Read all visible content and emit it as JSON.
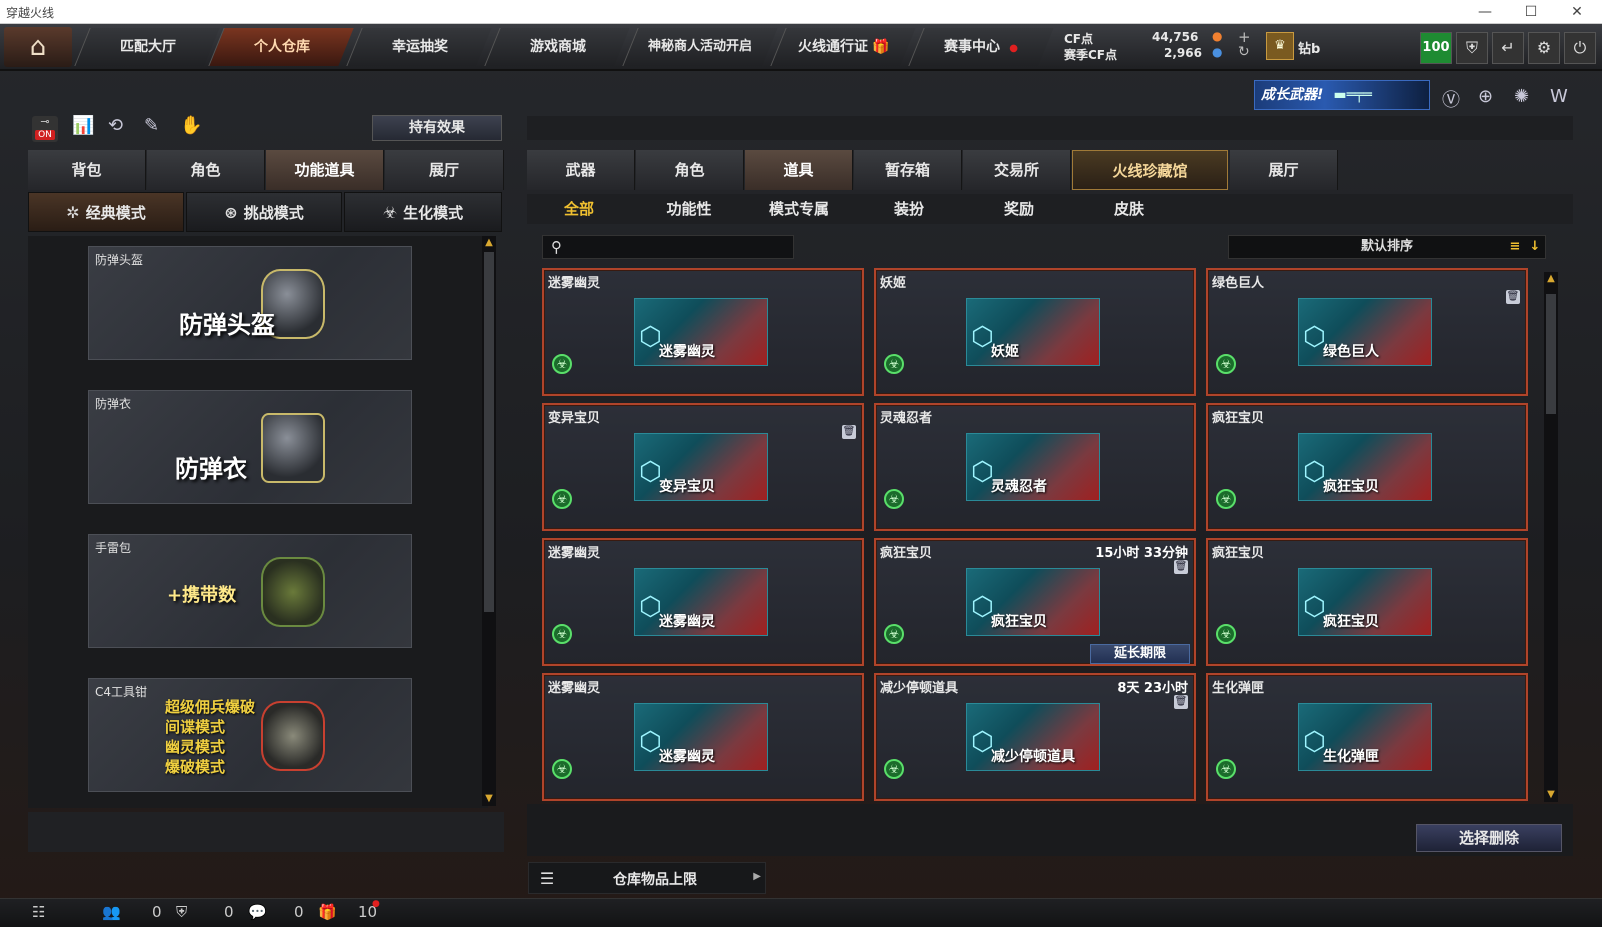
{
  "window": {
    "title": "穿越火线",
    "min": "—",
    "max": "☐",
    "close": "✕"
  },
  "nav": {
    "home_icon": "home-icon",
    "tabs": [
      {
        "label": "匹配大厅"
      },
      {
        "label": "个人仓库"
      },
      {
        "label": "幸运抽奖"
      },
      {
        "label": "游戏商城"
      },
      {
        "label": "神秘商人活动开启"
      },
      {
        "label": "火线通行证"
      },
      {
        "label": "赛事中心"
      }
    ],
    "cf_label": "CF点",
    "cf_value": "44,756",
    "season_cf_label": "赛季CF点",
    "season_cf_value": "2,966",
    "user_name": "钻b",
    "level": "100"
  },
  "banner": {
    "text": "成长武器!"
  },
  "left": {
    "hold_effect": "持有效果",
    "on_label": "ON",
    "tabs": [
      {
        "label": "背包"
      },
      {
        "label": "角色"
      },
      {
        "label": "功能道具"
      },
      {
        "label": "展厅"
      }
    ],
    "modes": [
      {
        "label": "经典模式"
      },
      {
        "label": "挑战模式"
      },
      {
        "label": "生化模式"
      }
    ],
    "items": [
      {
        "label": "防弹头盔",
        "art_text": "防弹头盔"
      },
      {
        "label": "防弹衣",
        "art_text": "防弹衣"
      },
      {
        "label": "手雷包",
        "art_text": "+携带数"
      },
      {
        "label": "C4工具钳",
        "art_lines": [
          "超级佣兵爆破",
          "间谍模式",
          "幽灵模式",
          "爆破模式"
        ]
      }
    ]
  },
  "right": {
    "tabs": [
      {
        "label": "武器"
      },
      {
        "label": "角色"
      },
      {
        "label": "道具"
      },
      {
        "label": "暂存箱"
      },
      {
        "label": "交易所"
      },
      {
        "label": "火线珍藏馆"
      },
      {
        "label": "展厅"
      }
    ],
    "subtabs": [
      {
        "label": "全部"
      },
      {
        "label": "功能性"
      },
      {
        "label": "模式专属"
      },
      {
        "label": "装扮"
      },
      {
        "label": "奖励"
      },
      {
        "label": "皮肤"
      }
    ],
    "search_placeholder": "",
    "sort_label": "默认排序",
    "cards": [
      {
        "name": "迷雾幽灵",
        "art": "迷雾幽灵",
        "time": "",
        "lock": false,
        "extend": ""
      },
      {
        "name": "妖姬",
        "art": "妖姬",
        "time": "",
        "lock": false,
        "extend": ""
      },
      {
        "name": "绿色巨人",
        "art": "绿色巨人",
        "time": "",
        "lock": true,
        "extend": ""
      },
      {
        "name": "变异宝贝",
        "art": "变异宝贝",
        "time": "",
        "lock": true,
        "extend": ""
      },
      {
        "name": "灵魂忍者",
        "art": "灵魂忍者",
        "time": "",
        "lock": false,
        "extend": ""
      },
      {
        "name": "疯狂宝贝",
        "art": "疯狂宝贝",
        "time": "",
        "lock": false,
        "extend": ""
      },
      {
        "name": "迷雾幽灵",
        "art": "迷雾幽灵",
        "time": "",
        "lock": false,
        "extend": ""
      },
      {
        "name": "疯狂宝贝",
        "art": "疯狂宝贝",
        "time": "15小时 33分钟",
        "lock": true,
        "extend": "延长期限"
      },
      {
        "name": "疯狂宝贝",
        "art": "疯狂宝贝",
        "time": "",
        "lock": false,
        "extend": ""
      },
      {
        "name": "迷雾幽灵",
        "art": "迷雾幽灵",
        "time": "",
        "lock": false,
        "extend": ""
      },
      {
        "name": "减少停顿道具",
        "art": "减少停顿道具",
        "time": "8天 23小时",
        "lock": true,
        "extend": ""
      },
      {
        "name": "生化弹匣",
        "art": "生化弹匣",
        "time": "",
        "lock": false,
        "extend": ""
      }
    ],
    "delete_button": "选择删除",
    "storage_limit": "仓库物品上限"
  },
  "bottom": {
    "counts": [
      "0",
      "0",
      "0",
      "10"
    ]
  },
  "colors": {
    "accent": "#f0c030",
    "card_border": "#b0442a",
    "level_badge": "#1e8b32"
  }
}
